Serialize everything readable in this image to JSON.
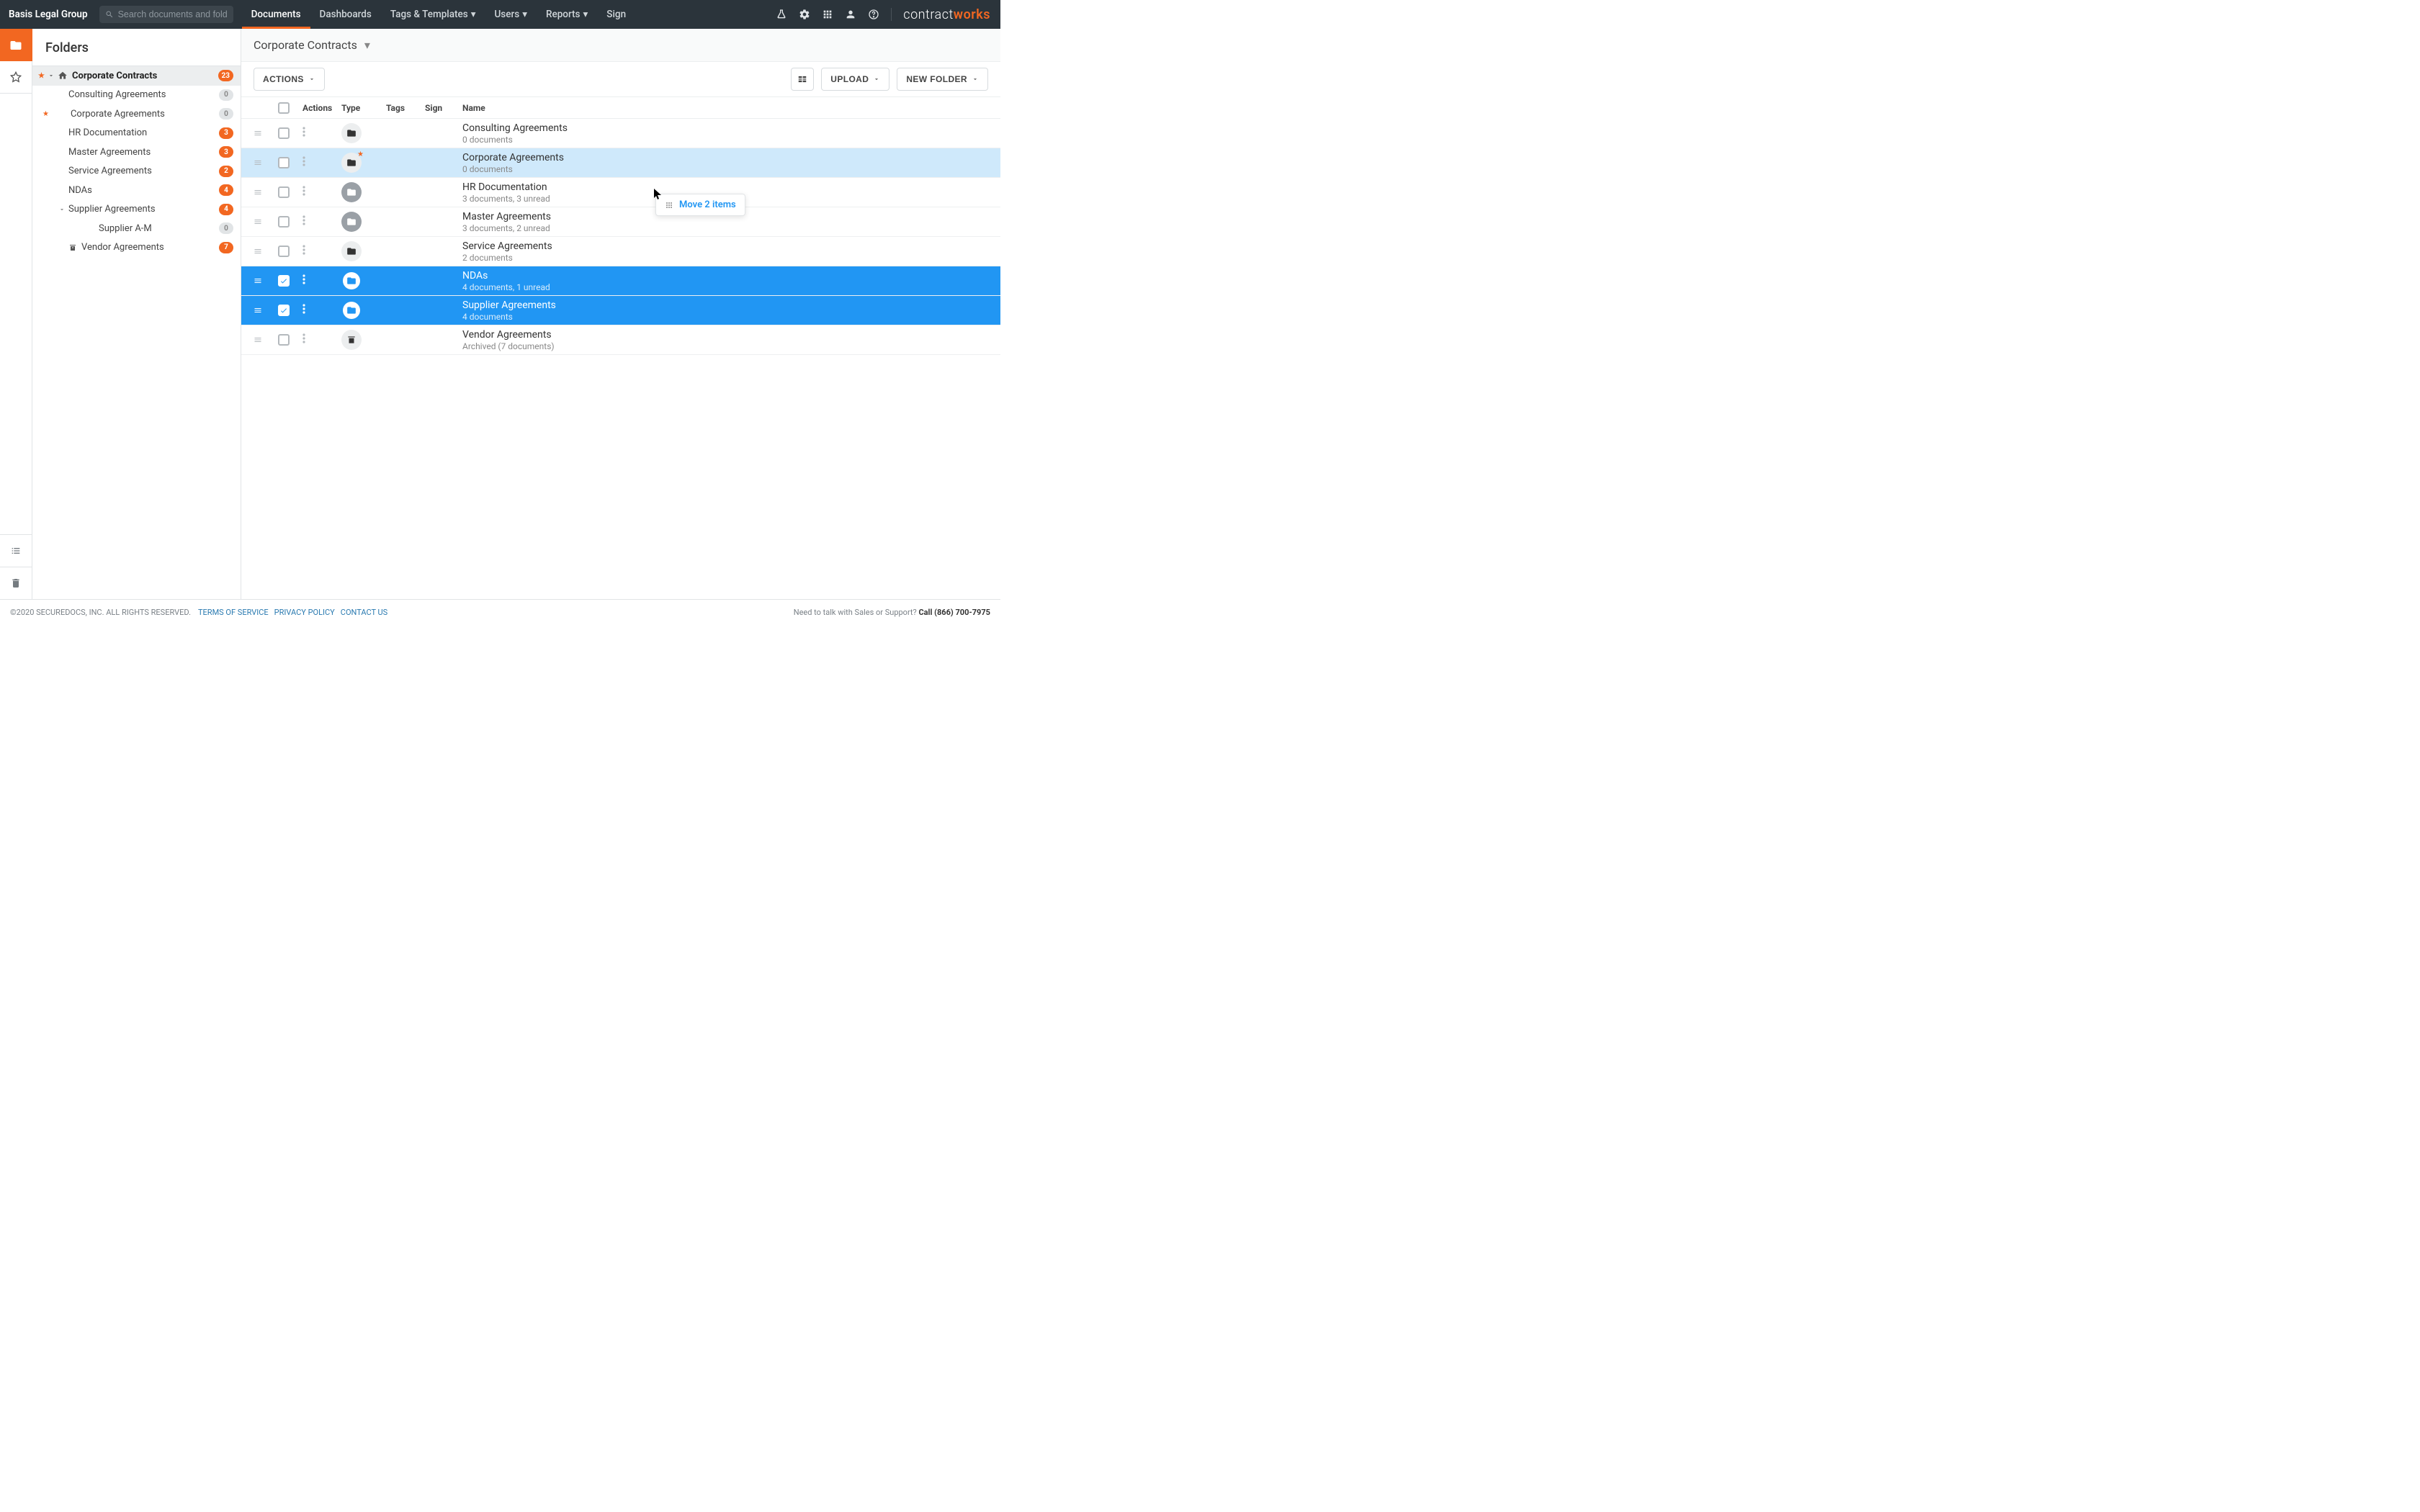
{
  "topnav": {
    "org": "Basis Legal Group",
    "search_placeholder": "Search documents and folders",
    "items": [
      "Documents",
      "Dashboards",
      "Tags & Templates",
      "Users",
      "Reports",
      "Sign"
    ],
    "active_index": 0,
    "brand_a": "contract",
    "brand_b": "works"
  },
  "sidebar": {
    "title": "Folders",
    "root": {
      "label": "Corporate Contracts",
      "count": 23
    },
    "items": [
      {
        "label": "Consulting Agreements",
        "count": 0,
        "badge": "gray",
        "indent": 1
      },
      {
        "label": "Corporate Agreements",
        "count": 0,
        "badge": "gray",
        "indent": 1,
        "starred": true
      },
      {
        "label": "HR Documentation",
        "count": 3,
        "badge": "orange",
        "indent": 1
      },
      {
        "label": "Master Agreements",
        "count": 3,
        "badge": "orange",
        "indent": 1
      },
      {
        "label": "Service Agreements",
        "count": 2,
        "badge": "orange",
        "indent": 1
      },
      {
        "label": "NDAs",
        "count": 4,
        "badge": "orange",
        "indent": 1
      },
      {
        "label": "Supplier Agreements",
        "count": 4,
        "badge": "orange",
        "indent": 1,
        "expandable": true
      },
      {
        "label": "Supplier A-M",
        "count": 0,
        "badge": "gray",
        "indent": 2
      },
      {
        "label": "Vendor Agreements",
        "count": 7,
        "badge": "orange",
        "indent": 1,
        "archive": true
      }
    ]
  },
  "breadcrumb": {
    "current": "Corporate Contracts"
  },
  "toolbar": {
    "actions": "ACTIONS",
    "upload": "UPLOAD",
    "new_folder": "NEW FOLDER"
  },
  "columns": {
    "actions": "Actions",
    "type": "Type",
    "tags": "Tags",
    "sign": "Sign",
    "name": "Name"
  },
  "rows": [
    {
      "title": "Consulting Agreements",
      "sub": "0 documents",
      "icon": "folder-dark"
    },
    {
      "title": "Corporate Agreements",
      "sub": "0 documents",
      "icon": "folder-dark",
      "starred": true,
      "row_state": "hover-blue"
    },
    {
      "title": "HR Documentation",
      "sub": "3 documents, 3 unread",
      "icon": "folder-gray"
    },
    {
      "title": "Master Agreements",
      "sub": "3 documents, 2 unread",
      "icon": "folder-gray"
    },
    {
      "title": "Service Agreements",
      "sub": "2 documents",
      "icon": "folder-dark"
    },
    {
      "title": "NDAs",
      "sub": "4 documents, 1 unread",
      "icon": "folder-blue",
      "row_state": "selected",
      "checked": true
    },
    {
      "title": "Supplier Agreements",
      "sub": "4 documents",
      "icon": "folder-blue",
      "row_state": "selected",
      "checked": true
    },
    {
      "title": "Vendor Agreements",
      "sub": "Archived (7 documents)",
      "icon": "archive"
    }
  ],
  "drag_tooltip": "Move 2 items",
  "footer": {
    "copyright": "©2020 SECUREDOCS, INC. ALL RIGHTS RESERVED.",
    "links": [
      "TERMS OF SERVICE",
      "PRIVACY POLICY",
      "CONTACT US"
    ],
    "support_prompt": "Need to talk with Sales or Support?",
    "phone": "Call (866) 700-7975"
  }
}
